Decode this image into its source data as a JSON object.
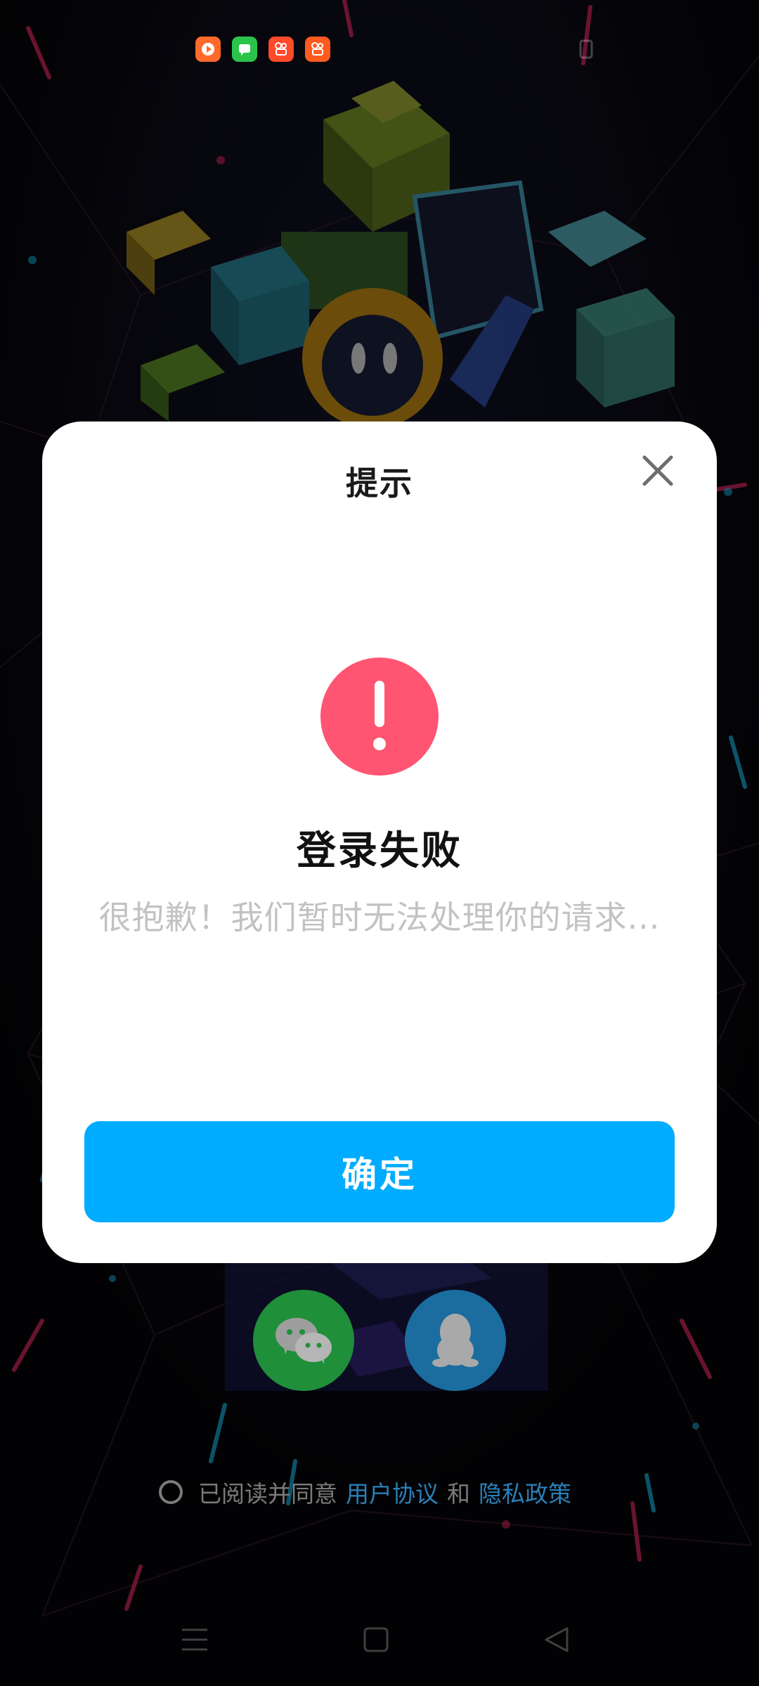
{
  "status_bar": {
    "app_icons": [
      {
        "name": "video-app-icon",
        "color": "#ff6a2b",
        "glyph": "▶"
      },
      {
        "name": "messages-app-icon",
        "color": "#2bc44a",
        "glyph": "▬"
      },
      {
        "name": "kuaishou-app-icon",
        "color": "#ff4a2a",
        "glyph": "✿"
      },
      {
        "name": "kuaishou-lite-app-icon",
        "color": "#ff5a1f",
        "glyph": "✿"
      }
    ]
  },
  "dialog": {
    "title": "提示",
    "headline": "登录失败",
    "message": "很抱歉！我们暂时无法处理你的请求...",
    "confirm_label": "确定",
    "alert_color": "#ff5572",
    "confirm_color": "#00acff"
  },
  "login": {
    "agreement_text": "已阅读并同意",
    "user_agreement": "用户协议",
    "and_text": "和",
    "privacy_policy": "隐私政策",
    "social": [
      "wechat",
      "qq"
    ]
  },
  "nav": {
    "buttons": [
      "menu",
      "home",
      "back"
    ]
  }
}
